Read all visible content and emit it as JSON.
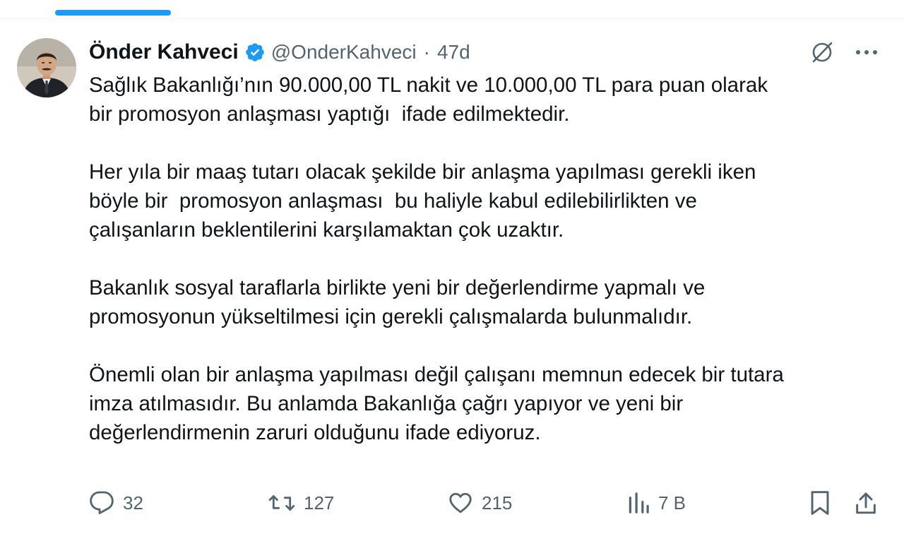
{
  "tab_indicator": {
    "color": "#1d9bf0"
  },
  "tweet": {
    "author": {
      "name": "Önder Kahveci",
      "handle": "@OnderKahveci",
      "verified_color": "#1d9bf0"
    },
    "separator": "·",
    "time": "47d",
    "header_actions": {
      "grok_icon": "grok-icon",
      "more_icon": "more-horizontal-icon"
    },
    "paragraphs": [
      "Sağlık Bakanlığı’nın 90.000,00 TL nakit ve 10.000,00 TL para puan olarak\nbir promosyon anlaşması yaptığı  ifade edilmektedir.",
      "Her yıla bir maaş tutarı olacak şekilde bir anlaşma yapılması gerekli iken\nböyle bir  promosyon anlaşması  bu haliyle kabul edilebilirlikten ve\nçalışanların beklentilerini karşılamaktan çok uzaktır.",
      "Bakanlık sosyal taraflarla birlikte yeni bir değerlendirme yapmalı ve\npromosyonun yükseltilmesi için gerekli çalışmalarda bulunmalıdır.",
      "Önemli olan bir anlaşma yapılması değil çalışanı memnun edecek bir tutara\nimza atılmasıdır. Bu anlamda Bakanlığa çağrı yapıyor ve yeni bir\ndeğerlendirmenin zaruri olduğunu ifade ediyoruz."
    ],
    "actions": {
      "replies": "32",
      "reposts": "127",
      "likes": "215",
      "views": "7 B"
    },
    "colors": {
      "text": "#0f1419",
      "secondary": "#536471"
    }
  }
}
